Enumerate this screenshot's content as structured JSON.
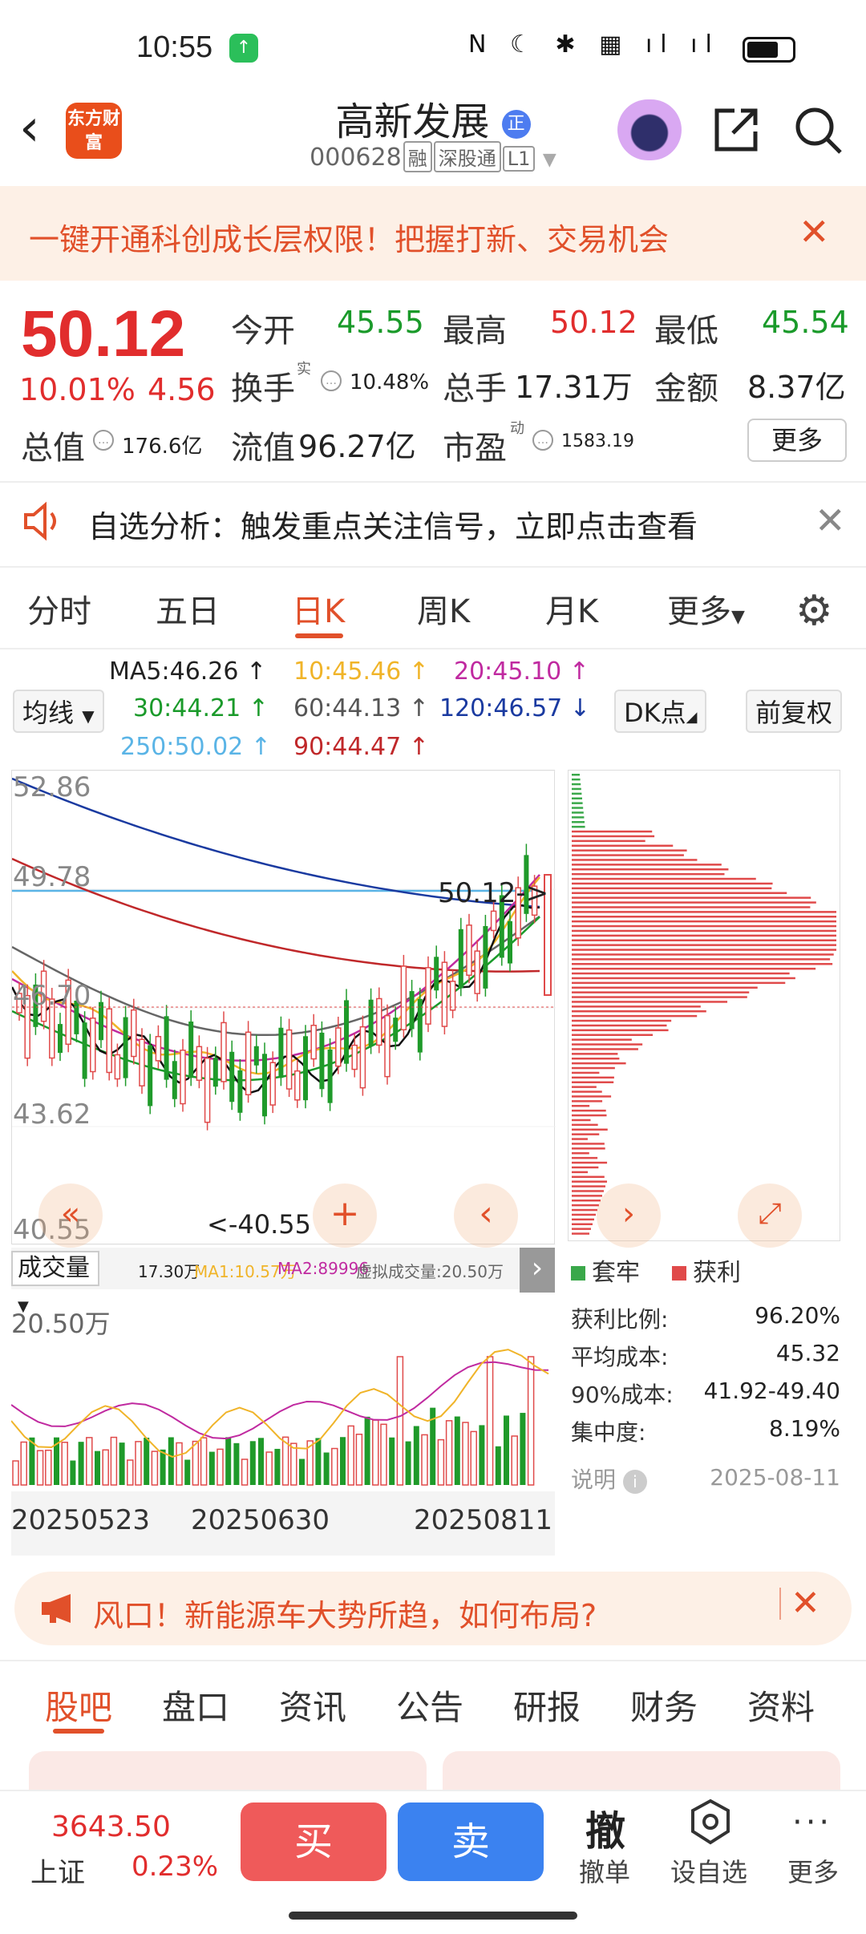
{
  "status": {
    "time": "10:55"
  },
  "header": {
    "logo": "东方财富",
    "title": "高新发展",
    "title_badge": "正",
    "code": "000628",
    "tags": [
      "融",
      "深股通",
      "L1"
    ]
  },
  "promo": {
    "text": "一键开通科创成长层权限！把握打新、交易机会"
  },
  "quote": {
    "price": "50.12",
    "pct": "10.01%",
    "chg": "4.56",
    "open_label": "今开",
    "open": "45.55",
    "high_label": "最高",
    "high": "50.12",
    "low_label": "最低",
    "low": "45.54",
    "turnover_label": "换手",
    "turnover_sup": "实",
    "turnover": "10.48%",
    "vol_label": "总手",
    "vol": "17.31万",
    "amount_label": "金额",
    "amount": "8.37亿",
    "mcap_label": "总值",
    "mcap": "176.6亿",
    "float_label": "流值",
    "float": "96.27亿",
    "pe_label": "市盈",
    "pe_sup": "动",
    "pe": "1583.19",
    "more": "更多"
  },
  "analysis": {
    "text": "自选分析：触发重点关注信号，立即点击查看"
  },
  "ktabs": [
    "分时",
    "五日",
    "日K",
    "周K",
    "月K",
    "更多"
  ],
  "ma": {
    "selector": "均线",
    "dk": "DK点",
    "adj": "前复权",
    "items": [
      {
        "text": "MA5:46.26 ↑",
        "color": "#222"
      },
      {
        "text": "10:45.46 ↑",
        "color": "#f0b429"
      },
      {
        "text": "20:45.10 ↑",
        "color": "#c02aa0"
      },
      {
        "text": "30:44.21 ↑",
        "color": "#1a9a2a"
      },
      {
        "text": "60:44.13 ↑",
        "color": "#555"
      },
      {
        "text": "120:46.57 ↓",
        "color": "#1a3aa0"
      },
      {
        "text": "250:50.02 ↑",
        "color": "#5ab4e6"
      },
      {
        "text": "90:44.47 ↑",
        "color": "#c0282a"
      }
    ]
  },
  "chart_data": {
    "type": "candlestick",
    "y_ticks": [
      "52.86",
      "49.78",
      "46.70",
      "43.62",
      "40.55"
    ],
    "ylim": [
      40.55,
      52.86
    ],
    "last_price_label": "50.12->",
    "low_label": "<-40.55",
    "x_ticks": [
      "20250523",
      "20250630",
      "20250811"
    ],
    "volume": {
      "header": "成交量",
      "vol": "17.30万",
      "ma1": "MA1:10.57万",
      "ma2": "MA2:89996",
      "virtual": "虚拟成交量:20.50万",
      "ymax_label": "20.50万"
    }
  },
  "chips": {
    "legend_trapped": "套牢",
    "legend_profit": "获利",
    "rows": [
      {
        "label": "获利比例:",
        "value": "96.20%"
      },
      {
        "label": "平均成本:",
        "value": "45.32"
      },
      {
        "label": "90%成本:",
        "value": "41.92-49.40"
      },
      {
        "label": "集中度:",
        "value": "8.19%"
      }
    ],
    "note": "说明",
    "date": "2025-08-11"
  },
  "ad2": {
    "text": "风口！新能源车大势所趋，如何布局?"
  },
  "btabs": [
    "股吧",
    "盘口",
    "资讯",
    "公告",
    "研报",
    "财务",
    "资料"
  ],
  "toolbar": {
    "index_value": "3643.50",
    "index_name": "上证",
    "index_pct": "0.23%",
    "buy": "买",
    "sell": "卖",
    "cancel_icon": "撤",
    "cancel": "撤单",
    "watch": "设自选",
    "more": "更多"
  }
}
